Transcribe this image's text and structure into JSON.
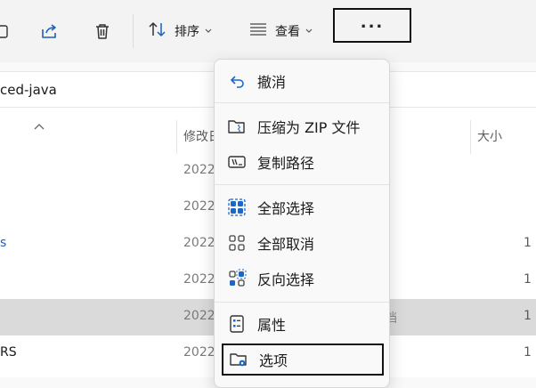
{
  "toolbar": {
    "sort_label": "排序",
    "view_label": "查看",
    "more_label": "..."
  },
  "address": {
    "path_fragment": "ced-java"
  },
  "list": {
    "headers": {
      "modified": "修改日",
      "size": "大小"
    },
    "rows": [
      {
        "name": "",
        "date": "2022",
        "type": "",
        "size": ""
      },
      {
        "name": "",
        "date": "2022",
        "type": "",
        "size": ""
      },
      {
        "name": "s",
        "date": "2022",
        "type": "",
        "size": "1"
      },
      {
        "name": "",
        "date": "2022",
        "type": "",
        "size": "1"
      },
      {
        "name": "",
        "date": "2022",
        "type": "档",
        "size": "1"
      },
      {
        "name": "RS",
        "date": "2022",
        "type": "",
        "size": "1"
      }
    ]
  },
  "context_menu": {
    "items": [
      {
        "label": "撤消",
        "icon": "undo-icon"
      },
      {
        "label": "压缩为 ZIP 文件",
        "icon": "zip-folder-icon"
      },
      {
        "label": "复制路径",
        "icon": "copy-path-icon"
      },
      {
        "label": "全部选择",
        "icon": "select-all-icon"
      },
      {
        "label": "全部取消",
        "icon": "select-none-icon"
      },
      {
        "label": "反向选择",
        "icon": "invert-selection-icon"
      },
      {
        "label": "属性",
        "icon": "properties-icon"
      },
      {
        "label": "选项",
        "icon": "folder-options-icon"
      }
    ]
  },
  "colors": {
    "accent": "#1a66c9",
    "selected_row": "#dadada"
  }
}
